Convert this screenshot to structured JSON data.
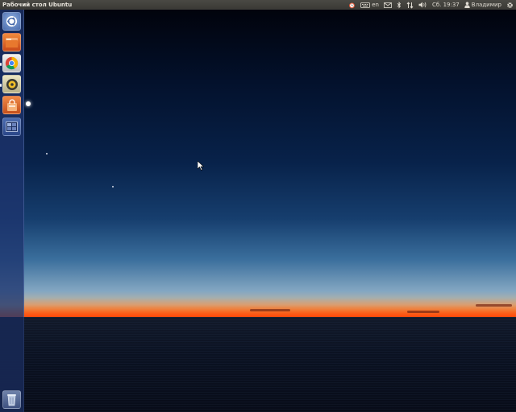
{
  "panel": {
    "title": "Рабочий стол Ubuntu",
    "keyboard_layout": "en",
    "clock": "Сб. 19:37",
    "user_name": "Владимир"
  },
  "indicators": [
    "alarm-clock-icon",
    "keyboard-icon",
    "mail-icon",
    "bluetooth-icon",
    "network-icon",
    "volume-icon",
    "user-icon",
    "gear-icon"
  ],
  "launcher": {
    "items": [
      {
        "name": "dash-home-button",
        "icon": "ubuntu-logo-icon",
        "color": "#6a8cc7"
      },
      {
        "name": "files-button",
        "icon": "folder-icon",
        "color": "#e0641c"
      },
      {
        "name": "chrome-button",
        "icon": "chrome-icon",
        "color": "#d9d9d9"
      },
      {
        "name": "rhythmbox-button",
        "icon": "speaker-icon",
        "color": "#d8d2a8"
      },
      {
        "name": "software-center-button",
        "icon": "shopping-bag-icon",
        "color": "#e06a28"
      },
      {
        "name": "workspace-switcher-button",
        "icon": "workspaces-icon",
        "color": "#3a5a9a"
      },
      {
        "name": "trash-button",
        "icon": "trash-icon",
        "color": "#5a6f98"
      }
    ]
  },
  "colors": {
    "panel_bg": "#3f3e39",
    "panel_text": "#dfdbd2",
    "launcher_bg": "#1e346e",
    "horizon_orange": "#ff5a10"
  }
}
